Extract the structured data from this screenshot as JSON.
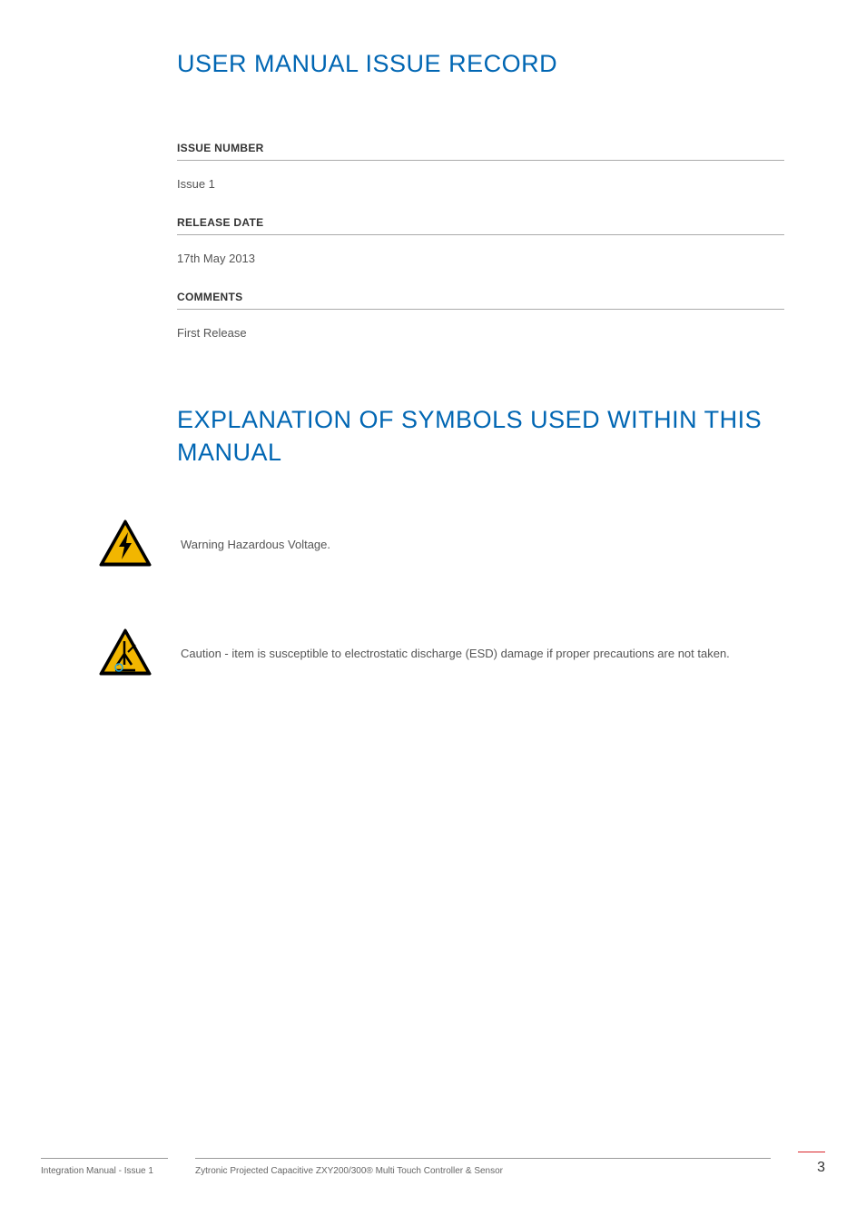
{
  "headings": {
    "issueRecord": "USER MANUAL ISSUE RECORD",
    "symbolsExplanation": "EXPLANATION OF SYMBOLS USED WITHIN THIS MANUAL"
  },
  "issueRecord": {
    "issueNumberLabel": "ISSUE NUMBER",
    "issueNumberValue": "Issue 1",
    "releaseDateLabel": "RELEASE DATE",
    "releaseDateValue": "17th May 2013",
    "commentsLabel": "COMMENTS",
    "commentsValue": "First Release"
  },
  "symbols": {
    "hazardousVoltage": "Warning Hazardous Voltage.",
    "esdCaution": "Caution - item is susceptible to electrostatic discharge (ESD) damage if proper precautions are not taken."
  },
  "footer": {
    "left": "Integration Manual - Issue 1",
    "center": "Zytronic Projected Capacitive ZXY200/300® Multi Touch Controller & Sensor",
    "pageNumber": "3"
  }
}
